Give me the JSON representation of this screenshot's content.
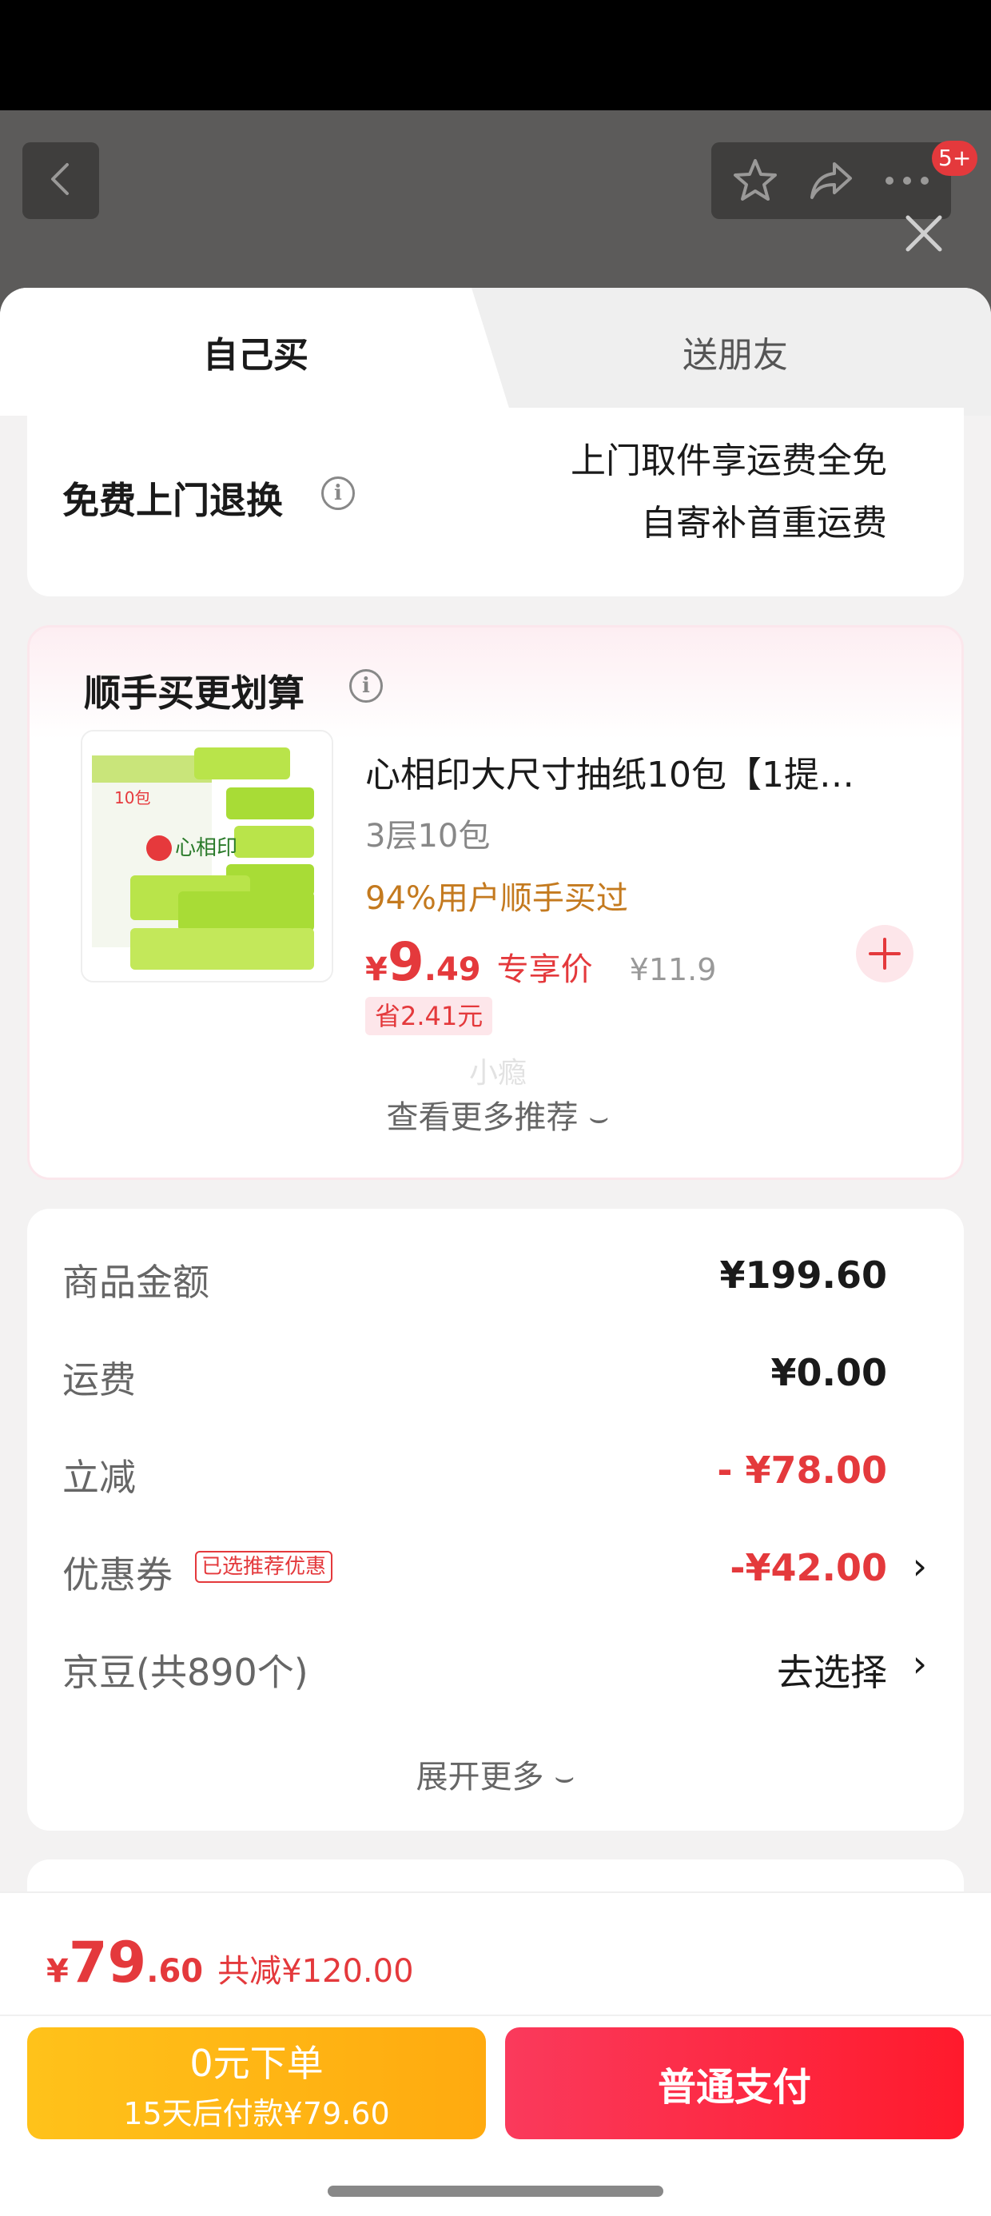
{
  "header": {
    "badge": "5+"
  },
  "tabs": {
    "self": "自己买",
    "friend": "送朋友"
  },
  "return_service": {
    "title": "免费上门退换",
    "line1": "上门取件享运费全免",
    "line2": "自寄补首重运费"
  },
  "addon": {
    "title": "顺手买更划算",
    "product": {
      "name": "心相印大尺寸抽纸10包【1提…",
      "spec": "3层10包",
      "popularity": "94%用户顺手买过",
      "price_symbol": "¥",
      "price_int": "9",
      "price_dec": ".49",
      "price_tag": "专享价",
      "original_price": "¥11.9",
      "save": "省2.41元",
      "image_brand": "心相印",
      "image_count": "10包"
    },
    "watermark": "小瘾",
    "more": "查看更多推荐 ⌣"
  },
  "summary": {
    "goods_label": "商品金额",
    "goods_value": "¥199.60",
    "shipping_label": "运费",
    "shipping_value": "¥0.00",
    "discount_label": "立减",
    "discount_value": "- ¥78.00",
    "coupon_label": "优惠券",
    "coupon_tag": "已选推荐优惠",
    "coupon_value": "-¥42.00",
    "jingdou_label": "京豆(共890个)",
    "jingdou_value": "去选择",
    "expand": "展开更多 ⌣"
  },
  "footer": {
    "total_symbol": "¥",
    "total_int": "79",
    "total_dec": ".60",
    "total_save": "共减¥120.00",
    "later_line1": "0元下单",
    "later_line2": "15天后付款¥79.60",
    "pay_label": "普通支付"
  },
  "colors": {
    "accent_red": "#e4393c",
    "pay_gradient_start": "#fa3a5c",
    "later_gradient_start": "#ffc21a"
  },
  "icons": [
    "back-arrow-icon",
    "star-icon",
    "share-icon",
    "more-dots-icon",
    "close-icon",
    "info-icon",
    "plus-icon",
    "chevron-right-icon"
  ]
}
